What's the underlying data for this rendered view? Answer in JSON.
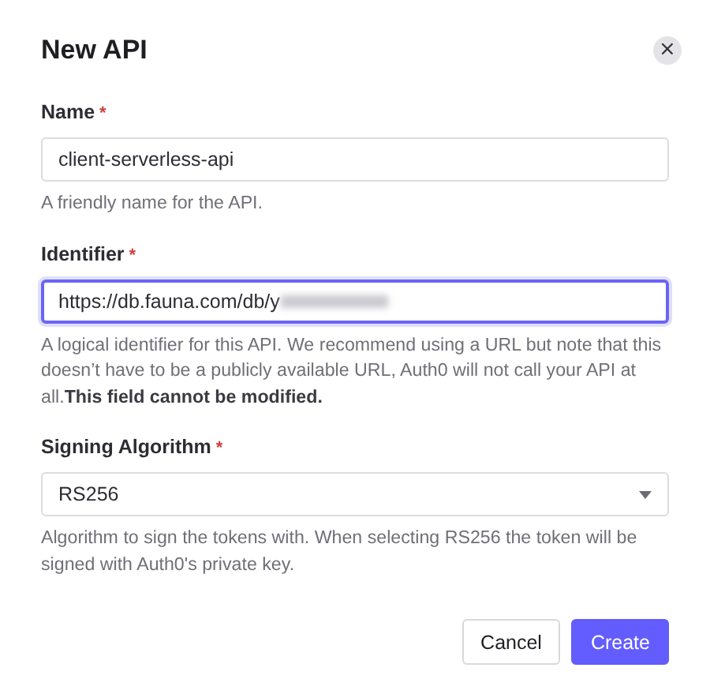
{
  "dialog": {
    "title": "New API",
    "close_icon": "×"
  },
  "fields": [
    {
      "kind": "text",
      "label": "Name",
      "required_mark": "*",
      "value": "client-serverless-api",
      "focused": false,
      "redacted": false,
      "help": "A friendly name for the API."
    },
    {
      "kind": "text",
      "label": "Identifier",
      "required_mark": "*",
      "value": "https://db.fauna.com/db/y",
      "focused": true,
      "redacted": true,
      "help": "A logical identifier for this API. We recommend using a URL but note that this doesn’t have to be a publicly available URL, Auth0 will not call your API at all.**This field cannot be modified.**"
    },
    {
      "kind": "select",
      "label": "Signing Algorithm",
      "required_mark": "*",
      "value": "RS256",
      "focused": false,
      "redacted": false,
      "help": "Algorithm to sign the tokens with. When selecting RS256 the token will be signed with Auth0's private key."
    }
  ],
  "buttons": [
    {
      "label": "Cancel",
      "kind": "secondary"
    },
    {
      "label": "Create",
      "kind": "primary"
    }
  ]
}
